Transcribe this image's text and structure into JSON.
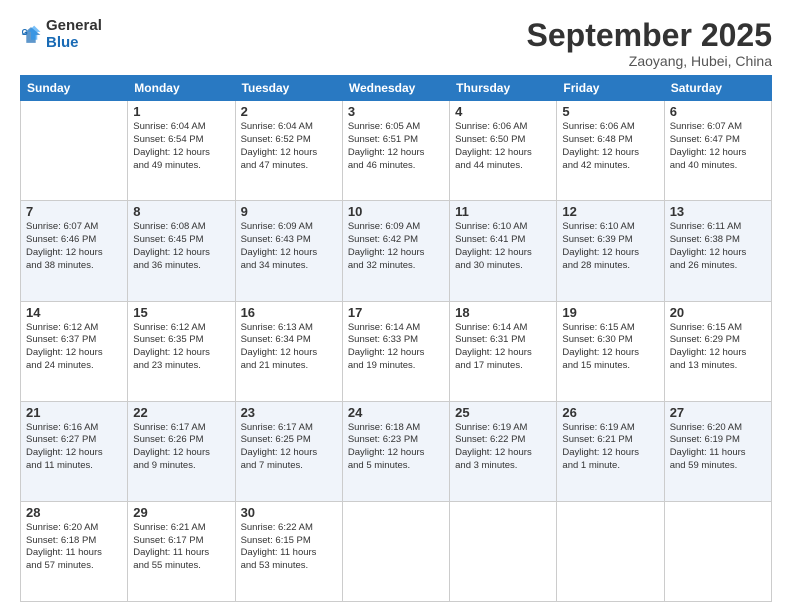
{
  "logo": {
    "text1": "General",
    "text2": "Blue"
  },
  "header": {
    "title": "September 2025",
    "subtitle": "Zaoyang, Hubei, China"
  },
  "weekdays": [
    "Sunday",
    "Monday",
    "Tuesday",
    "Wednesday",
    "Thursday",
    "Friday",
    "Saturday"
  ],
  "weeks": [
    [
      {
        "day": "",
        "info": ""
      },
      {
        "day": "1",
        "info": "Sunrise: 6:04 AM\nSunset: 6:54 PM\nDaylight: 12 hours\nand 49 minutes."
      },
      {
        "day": "2",
        "info": "Sunrise: 6:04 AM\nSunset: 6:52 PM\nDaylight: 12 hours\nand 47 minutes."
      },
      {
        "day": "3",
        "info": "Sunrise: 6:05 AM\nSunset: 6:51 PM\nDaylight: 12 hours\nand 46 minutes."
      },
      {
        "day": "4",
        "info": "Sunrise: 6:06 AM\nSunset: 6:50 PM\nDaylight: 12 hours\nand 44 minutes."
      },
      {
        "day": "5",
        "info": "Sunrise: 6:06 AM\nSunset: 6:48 PM\nDaylight: 12 hours\nand 42 minutes."
      },
      {
        "day": "6",
        "info": "Sunrise: 6:07 AM\nSunset: 6:47 PM\nDaylight: 12 hours\nand 40 minutes."
      }
    ],
    [
      {
        "day": "7",
        "info": "Sunrise: 6:07 AM\nSunset: 6:46 PM\nDaylight: 12 hours\nand 38 minutes."
      },
      {
        "day": "8",
        "info": "Sunrise: 6:08 AM\nSunset: 6:45 PM\nDaylight: 12 hours\nand 36 minutes."
      },
      {
        "day": "9",
        "info": "Sunrise: 6:09 AM\nSunset: 6:43 PM\nDaylight: 12 hours\nand 34 minutes."
      },
      {
        "day": "10",
        "info": "Sunrise: 6:09 AM\nSunset: 6:42 PM\nDaylight: 12 hours\nand 32 minutes."
      },
      {
        "day": "11",
        "info": "Sunrise: 6:10 AM\nSunset: 6:41 PM\nDaylight: 12 hours\nand 30 minutes."
      },
      {
        "day": "12",
        "info": "Sunrise: 6:10 AM\nSunset: 6:39 PM\nDaylight: 12 hours\nand 28 minutes."
      },
      {
        "day": "13",
        "info": "Sunrise: 6:11 AM\nSunset: 6:38 PM\nDaylight: 12 hours\nand 26 minutes."
      }
    ],
    [
      {
        "day": "14",
        "info": "Sunrise: 6:12 AM\nSunset: 6:37 PM\nDaylight: 12 hours\nand 24 minutes."
      },
      {
        "day": "15",
        "info": "Sunrise: 6:12 AM\nSunset: 6:35 PM\nDaylight: 12 hours\nand 23 minutes."
      },
      {
        "day": "16",
        "info": "Sunrise: 6:13 AM\nSunset: 6:34 PM\nDaylight: 12 hours\nand 21 minutes."
      },
      {
        "day": "17",
        "info": "Sunrise: 6:14 AM\nSunset: 6:33 PM\nDaylight: 12 hours\nand 19 minutes."
      },
      {
        "day": "18",
        "info": "Sunrise: 6:14 AM\nSunset: 6:31 PM\nDaylight: 12 hours\nand 17 minutes."
      },
      {
        "day": "19",
        "info": "Sunrise: 6:15 AM\nSunset: 6:30 PM\nDaylight: 12 hours\nand 15 minutes."
      },
      {
        "day": "20",
        "info": "Sunrise: 6:15 AM\nSunset: 6:29 PM\nDaylight: 12 hours\nand 13 minutes."
      }
    ],
    [
      {
        "day": "21",
        "info": "Sunrise: 6:16 AM\nSunset: 6:27 PM\nDaylight: 12 hours\nand 11 minutes."
      },
      {
        "day": "22",
        "info": "Sunrise: 6:17 AM\nSunset: 6:26 PM\nDaylight: 12 hours\nand 9 minutes."
      },
      {
        "day": "23",
        "info": "Sunrise: 6:17 AM\nSunset: 6:25 PM\nDaylight: 12 hours\nand 7 minutes."
      },
      {
        "day": "24",
        "info": "Sunrise: 6:18 AM\nSunset: 6:23 PM\nDaylight: 12 hours\nand 5 minutes."
      },
      {
        "day": "25",
        "info": "Sunrise: 6:19 AM\nSunset: 6:22 PM\nDaylight: 12 hours\nand 3 minutes."
      },
      {
        "day": "26",
        "info": "Sunrise: 6:19 AM\nSunset: 6:21 PM\nDaylight: 12 hours\nand 1 minute."
      },
      {
        "day": "27",
        "info": "Sunrise: 6:20 AM\nSunset: 6:19 PM\nDaylight: 11 hours\nand 59 minutes."
      }
    ],
    [
      {
        "day": "28",
        "info": "Sunrise: 6:20 AM\nSunset: 6:18 PM\nDaylight: 11 hours\nand 57 minutes."
      },
      {
        "day": "29",
        "info": "Sunrise: 6:21 AM\nSunset: 6:17 PM\nDaylight: 11 hours\nand 55 minutes."
      },
      {
        "day": "30",
        "info": "Sunrise: 6:22 AM\nSunset: 6:15 PM\nDaylight: 11 hours\nand 53 minutes."
      },
      {
        "day": "",
        "info": ""
      },
      {
        "day": "",
        "info": ""
      },
      {
        "day": "",
        "info": ""
      },
      {
        "day": "",
        "info": ""
      }
    ]
  ]
}
